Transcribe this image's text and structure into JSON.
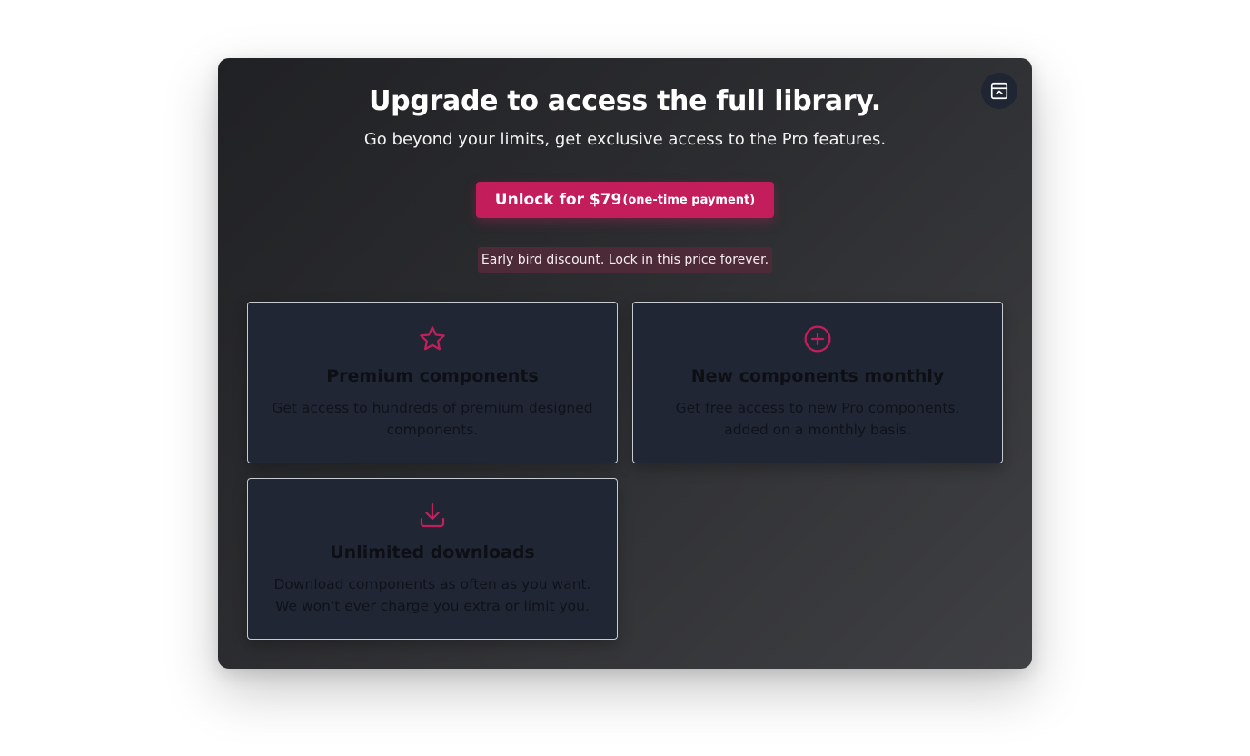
{
  "modal": {
    "title": "Upgrade to access the full library.",
    "subtitle": "Go beyond your limits, get exclusive access to the Pro features.",
    "corner_button_icon": "collapse-window-icon",
    "cta": {
      "label": "Unlock for $79",
      "note": "(one-time payment)"
    },
    "badge": "Early bird discount. Lock in this price forever.",
    "features": [
      {
        "icon": "star-icon",
        "title": "Premium components",
        "description": "Get access to hundreds of premium designed components."
      },
      {
        "icon": "plus-circle-icon",
        "title": "New components monthly",
        "description": "Get free access to new Pro components, added on a monthly basis."
      },
      {
        "icon": "download-icon",
        "title": "Unlimited downloads",
        "description": "Download components as often as you want. We won't ever charge you extra or limit you."
      }
    ]
  },
  "colors": {
    "accent": "#c41d5c",
    "modal_background": "#2c2d30",
    "card_background": "#202634",
    "badge_background": "#4c2a38"
  }
}
